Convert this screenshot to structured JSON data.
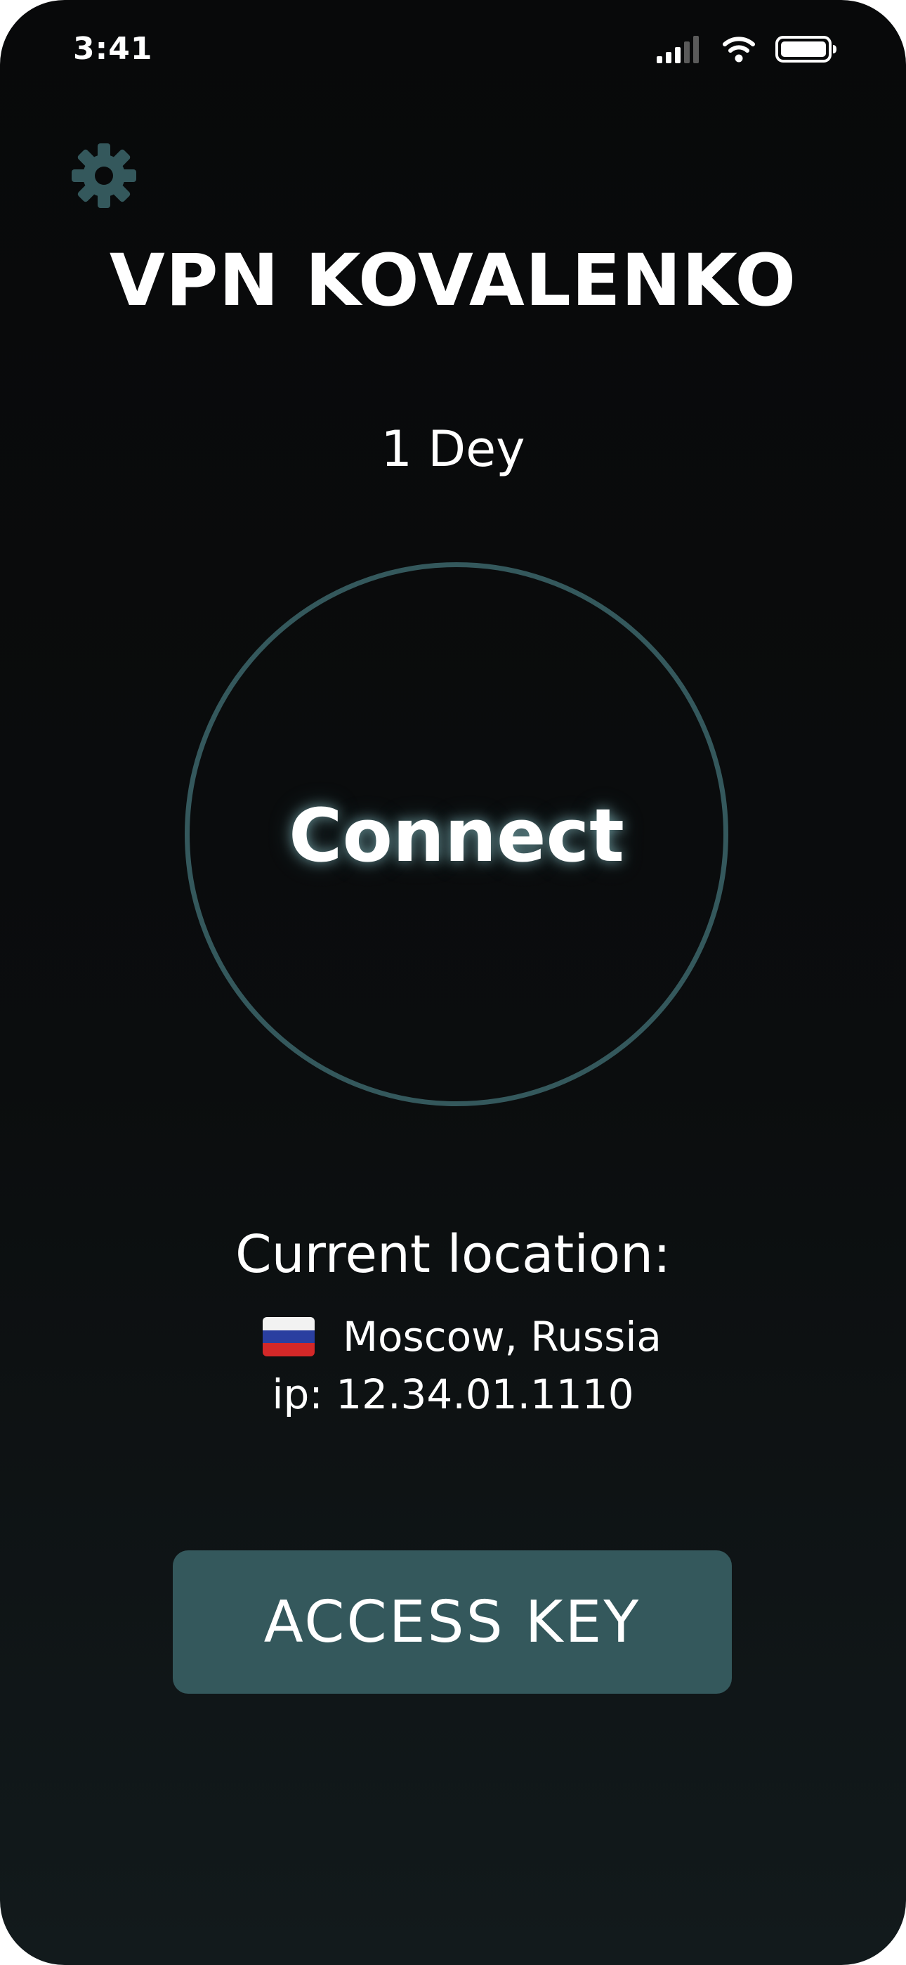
{
  "status_bar": {
    "time": "3:41",
    "signal_icon": "cellular-signal-icon",
    "wifi_icon": "wifi-icon",
    "battery_icon": "battery-icon"
  },
  "settings": {
    "icon": "gear-icon"
  },
  "app_title": "VPN KOVALENKO",
  "subscription": {
    "days_left": "1 Dey"
  },
  "connect_button": {
    "label": "Connect"
  },
  "location": {
    "heading": "Current location:",
    "flag_icon": "russia-flag-icon",
    "city": "Moscow, Russia",
    "ip": "ip: 12.34.01.1110"
  },
  "access_key_button": {
    "label": "ACCESS KEY"
  },
  "colors": {
    "background": "#08090a",
    "accent": "#34585c",
    "gear": "#34585c",
    "text": "#ffffff",
    "flag_white": "#f2f2f2",
    "flag_blue": "#2a3fa0",
    "flag_red": "#d32828"
  }
}
